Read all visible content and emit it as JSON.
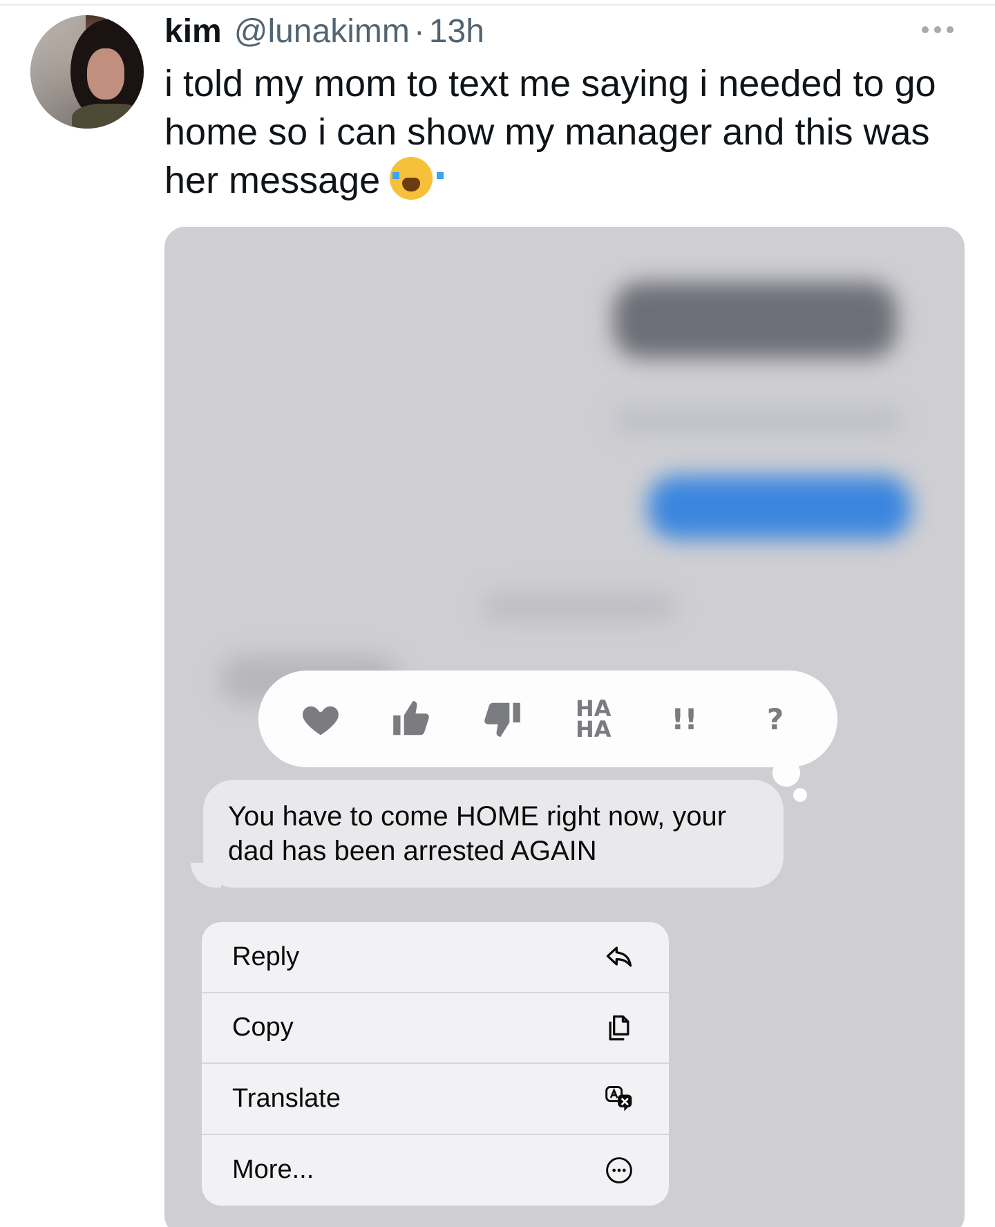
{
  "tweet": {
    "author_name": "kim",
    "author_handle": "@lunakimm",
    "separator": "·",
    "time": "13h",
    "text": "i told my mom to text me saying i needed to go home so i can show my manager and this was her message",
    "emoji": "loudly-crying-face"
  },
  "screenshot": {
    "reactions": [
      {
        "name": "heart",
        "label": ""
      },
      {
        "name": "thumbs-up",
        "label": ""
      },
      {
        "name": "thumbs-down",
        "label": ""
      },
      {
        "name": "haha",
        "label": "HA HA"
      },
      {
        "name": "exclamation",
        "label": "!!"
      },
      {
        "name": "question",
        "label": "?"
      }
    ],
    "message": "You have to come HOME right now, your dad has been arrested AGAIN",
    "menu": [
      {
        "label": "Reply",
        "icon": "reply-icon"
      },
      {
        "label": "Copy",
        "icon": "copy-icon"
      },
      {
        "label": "Translate",
        "icon": "translate-icon"
      },
      {
        "label": "More...",
        "icon": "more-circle-icon"
      }
    ]
  },
  "colors": {
    "handle_gray": "#536471",
    "media_bg": "#cfcfd3",
    "bubble_bg": "#e9e9eb",
    "blurred_blue": "#3b86de"
  }
}
